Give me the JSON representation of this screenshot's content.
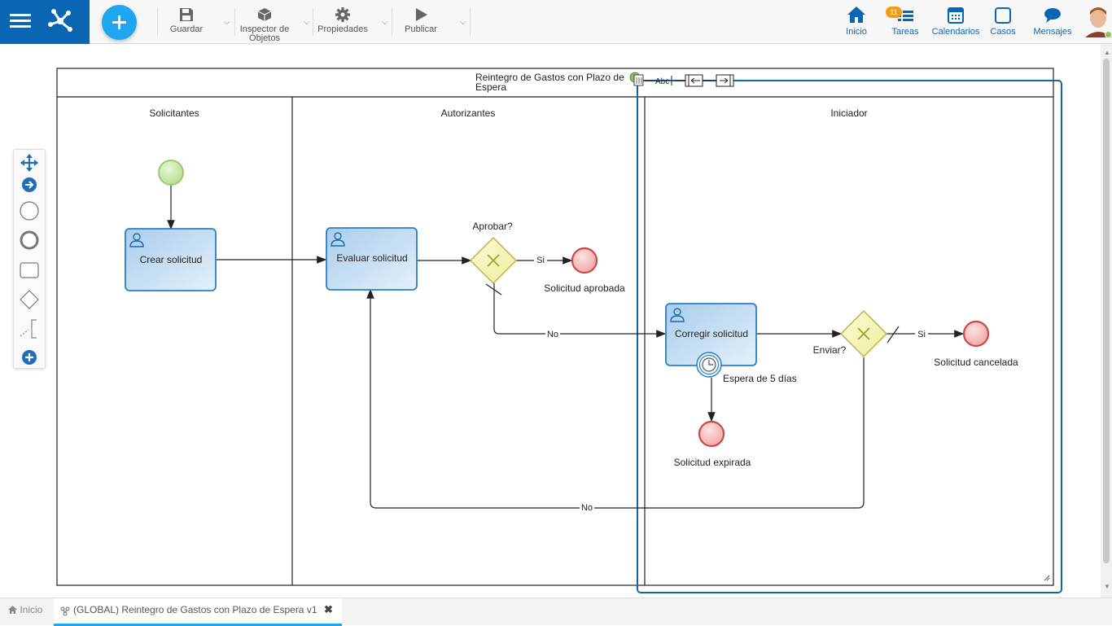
{
  "toolbar": {
    "save_label": "Guardar",
    "inspector_label_1": "Inspector de",
    "inspector_label_2": "Objetos",
    "properties_label": "Propiedades",
    "publish_label": "Publicar"
  },
  "nav": {
    "home": "Inicio",
    "tasks": "Tareas",
    "tasks_badge": "11",
    "calendars": "Calendarios",
    "cases": "Casos",
    "messages": "Mensajes"
  },
  "diagram": {
    "pool_title_1": "Reintegro de Gastos con Plazo de",
    "pool_title_2": "Espera",
    "inline_text_tool": "Abc",
    "lanes": [
      "Solicitantes",
      "Autorizantes",
      "Iniciador"
    ],
    "tasks": {
      "create": "Crear solicitud",
      "evaluate": "Evaluar solicitud",
      "correct": "Corregir solicitud"
    },
    "gateways": {
      "approve": "Aprobar?",
      "send": "Enviar?"
    },
    "events": {
      "approved": "Solicitud aprobada",
      "cancelled": "Solicitud cancelada",
      "expired": "Solicitud expirada",
      "timer": "Espera de 5 días"
    },
    "flows": {
      "yes1": "Si",
      "no1": "No",
      "yes2": "Si",
      "no2": "No"
    }
  },
  "tabs": {
    "home": "Inicio",
    "active": "(GLOBAL) Reintegro de Gastos con Plazo de Espera v1"
  },
  "colors": {
    "brand": "#0a66b3",
    "accent": "#1ea7f0",
    "task_fill": "#b8d6ee",
    "start_event": "#c8e6a8",
    "end_event": "#f4b6b6",
    "gateway": "#f4f3b0"
  }
}
